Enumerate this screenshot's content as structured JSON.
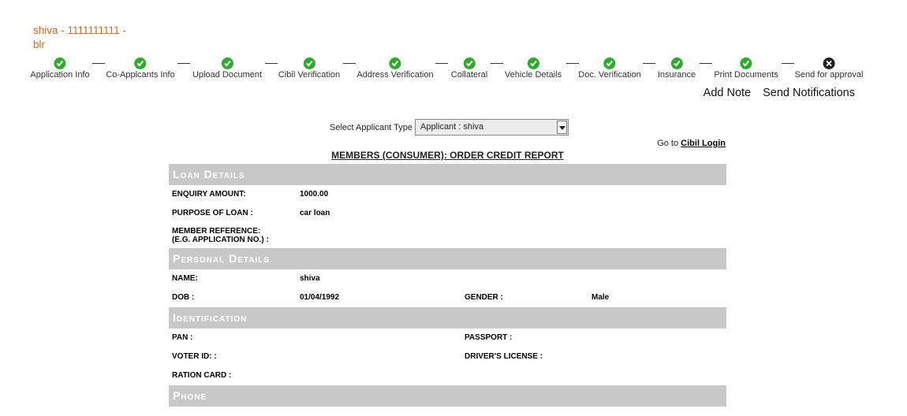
{
  "header": {
    "applicant_line1": "shiva - 1111111111 -",
    "applicant_line2": "blr"
  },
  "steps": [
    {
      "label": "Application Info",
      "status": "done"
    },
    {
      "label": "Co-Applcants Info",
      "status": "done"
    },
    {
      "label": "Upload Document",
      "status": "done"
    },
    {
      "label": "Cibil Verification",
      "status": "done"
    },
    {
      "label": "Address Verification",
      "status": "done"
    },
    {
      "label": "Collateral",
      "status": "done"
    },
    {
      "label": "Vehicle Details",
      "status": "done"
    },
    {
      "label": "Doc. Verification",
      "status": "done"
    },
    {
      "label": "Insurance",
      "status": "done"
    },
    {
      "label": "Print Documents",
      "status": "done"
    },
    {
      "label": "Send for approval",
      "status": "pending"
    }
  ],
  "actions": {
    "add_note": "Add Note",
    "send_notifications": "Send Notifications"
  },
  "selector": {
    "label": "Select Applicant Type",
    "value": "Applicant : shiva"
  },
  "goto": {
    "prefix": "Go to",
    "link": "Cibil Login"
  },
  "report_title": "MEMBERS (CONSUMER): ORDER CREDIT REPORT",
  "loan_details": {
    "title": "Loan Details",
    "enquiry_amount_label": "ENQUIRY AMOUNT:",
    "enquiry_amount": "1000.00",
    "purpose_label": "PURPOSE OF LOAN :",
    "purpose": "car loan",
    "member_ref_label_1": "MEMBER REFERENCE:",
    "member_ref_label_2": "(E.G. APPLICATION NO.) :"
  },
  "personal_details": {
    "title": "Personal Details",
    "name_label": "NAME:",
    "name": "shiva",
    "dob_label": "DOB :",
    "dob": "01/04/1992",
    "gender_label": "GENDER :",
    "gender": "Male"
  },
  "identification": {
    "title": "Identification",
    "pan_label": "PAN :",
    "passport_label": "PASSPORT :",
    "voter_label": "VOTER ID: :",
    "driver_label": "DRIVER'S LICENSE :",
    "ration_label": "RATION CARD :"
  },
  "phone": {
    "title": "Phone"
  },
  "colors": {
    "done": "#2eaa2e",
    "pending": "#222222",
    "section_bg": "#c8c8c8",
    "title": "#d2691e"
  }
}
